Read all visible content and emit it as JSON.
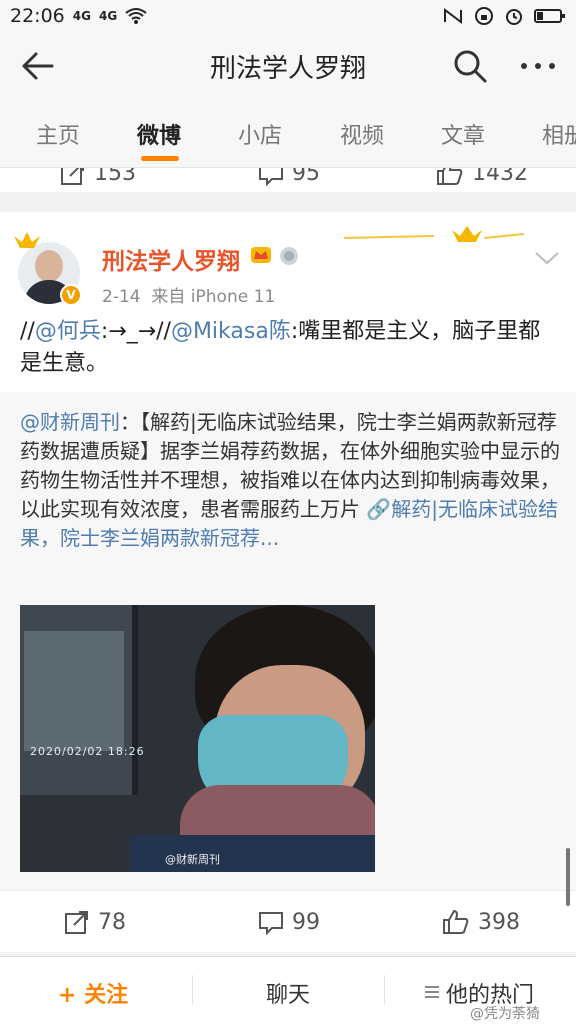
{
  "status_bar": {
    "time": "22:06",
    "signal1": "4G",
    "signal2": "4G",
    "icons": [
      "wifi-icon",
      "nfc-icon",
      "lock-icon",
      "alarm-icon",
      "battery-icon"
    ]
  },
  "header": {
    "title": "刑法学人罗翔",
    "icons": {
      "back": "back-arrow-icon",
      "search": "search-icon",
      "more": "more-icon"
    }
  },
  "tabs": [
    {
      "label": "主页"
    },
    {
      "label": "微博"
    },
    {
      "label": "小店"
    },
    {
      "label": "视频"
    },
    {
      "label": "文章"
    },
    {
      "label": "相册"
    }
  ],
  "top_actions": {
    "repost": "153",
    "comment": "95",
    "like": "1432"
  },
  "post": {
    "author": "刑法学人罗翔",
    "date": "2-14",
    "source": "来自 iPhone 11",
    "verified_badge": "V",
    "text": {
      "prefix": "//",
      "mention1": "@何兵",
      "middle": ":→_→//",
      "mention2": "@Mikasa陈",
      "body": ":嘴里都是主义，脑子里都是生意。"
    },
    "repost": {
      "mention": "@财新周刊",
      "body": "：【解药|无临床试验结果，院士李兰娟两款新冠荐药数据遭质疑】据李兰娟荐药数据，在体外细胞实验中显示的药物生物活性并不理想，被指难以在体内达到抑制病毒效果，以此实现有效浓度，患者需服药上万片",
      "link": "🔗解药|无临床试验结果，院士李兰娟两款新冠荐...",
      "image": {
        "timestamp": "2020/02/02 18:26",
        "watermark": "@财新周刊"
      }
    }
  },
  "bottom_actions": {
    "repost": "78",
    "comment": "99",
    "like": "398"
  },
  "bottom_bar": {
    "follow": "+ 关注",
    "chat": "聊天",
    "hot": "他的热门",
    "watermark": "@凭为荼猗"
  },
  "colors": {
    "accent": "#ff8200",
    "author": "#e8552b",
    "mention": "#507daf"
  }
}
